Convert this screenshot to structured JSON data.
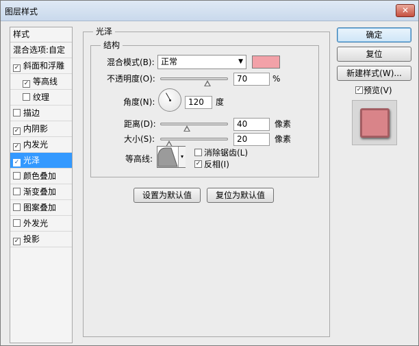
{
  "window": {
    "title": "图层样式",
    "close_glyph": "✕"
  },
  "style_list": {
    "header": "样式",
    "blend_options": "混合选项:自定",
    "items": [
      {
        "label": "斜面和浮雕",
        "checked": true,
        "check": "✓"
      },
      {
        "label": "等高线",
        "checked": true,
        "check": "✓",
        "sub": true
      },
      {
        "label": "纹理",
        "checked": false,
        "check": "",
        "sub": true
      },
      {
        "label": "描边",
        "checked": false,
        "check": ""
      },
      {
        "label": "内阴影",
        "checked": true,
        "check": "✓"
      },
      {
        "label": "内发光",
        "checked": true,
        "check": "✓"
      },
      {
        "label": "光泽",
        "checked": true,
        "check": "✓",
        "selected": true
      },
      {
        "label": "颜色叠加",
        "checked": false,
        "check": ""
      },
      {
        "label": "渐变叠加",
        "checked": false,
        "check": ""
      },
      {
        "label": "图案叠加",
        "checked": false,
        "check": ""
      },
      {
        "label": "外发光",
        "checked": false,
        "check": ""
      },
      {
        "label": "投影",
        "checked": true,
        "check": "✓"
      }
    ]
  },
  "satin": {
    "group_title": "光泽",
    "structure_title": "结构",
    "blend_mode_label": "混合模式(B):",
    "blend_mode_value": "正常",
    "blend_mode_arrow": "▼",
    "color": "#f2a1a8",
    "opacity_label": "不透明度(O):",
    "opacity_value": "70",
    "opacity_unit": "%",
    "angle_label": "角度(N):",
    "angle_value": "120",
    "angle_unit": "度",
    "distance_label": "距离(D):",
    "distance_value": "40",
    "distance_unit": "像素",
    "size_label": "大小(S):",
    "size_value": "20",
    "size_unit": "像素",
    "contour_label": "等高线:",
    "contour_arrow": "▾",
    "anti_alias_label": "消除锯齿(L)",
    "anti_alias_checked": false,
    "anti_alias_check": "",
    "invert_label": "反相(I)",
    "invert_checked": true,
    "invert_check": "✓",
    "set_default": "设置为默认值",
    "reset_default": "复位为默认值"
  },
  "actions": {
    "ok": "确定",
    "reset": "复位",
    "new_style": "新建样式(W)...",
    "preview_label": "预览(V)",
    "preview_check": "✓"
  },
  "colors": {
    "selection": "#3399ff",
    "preview_fill": "#d98489"
  }
}
